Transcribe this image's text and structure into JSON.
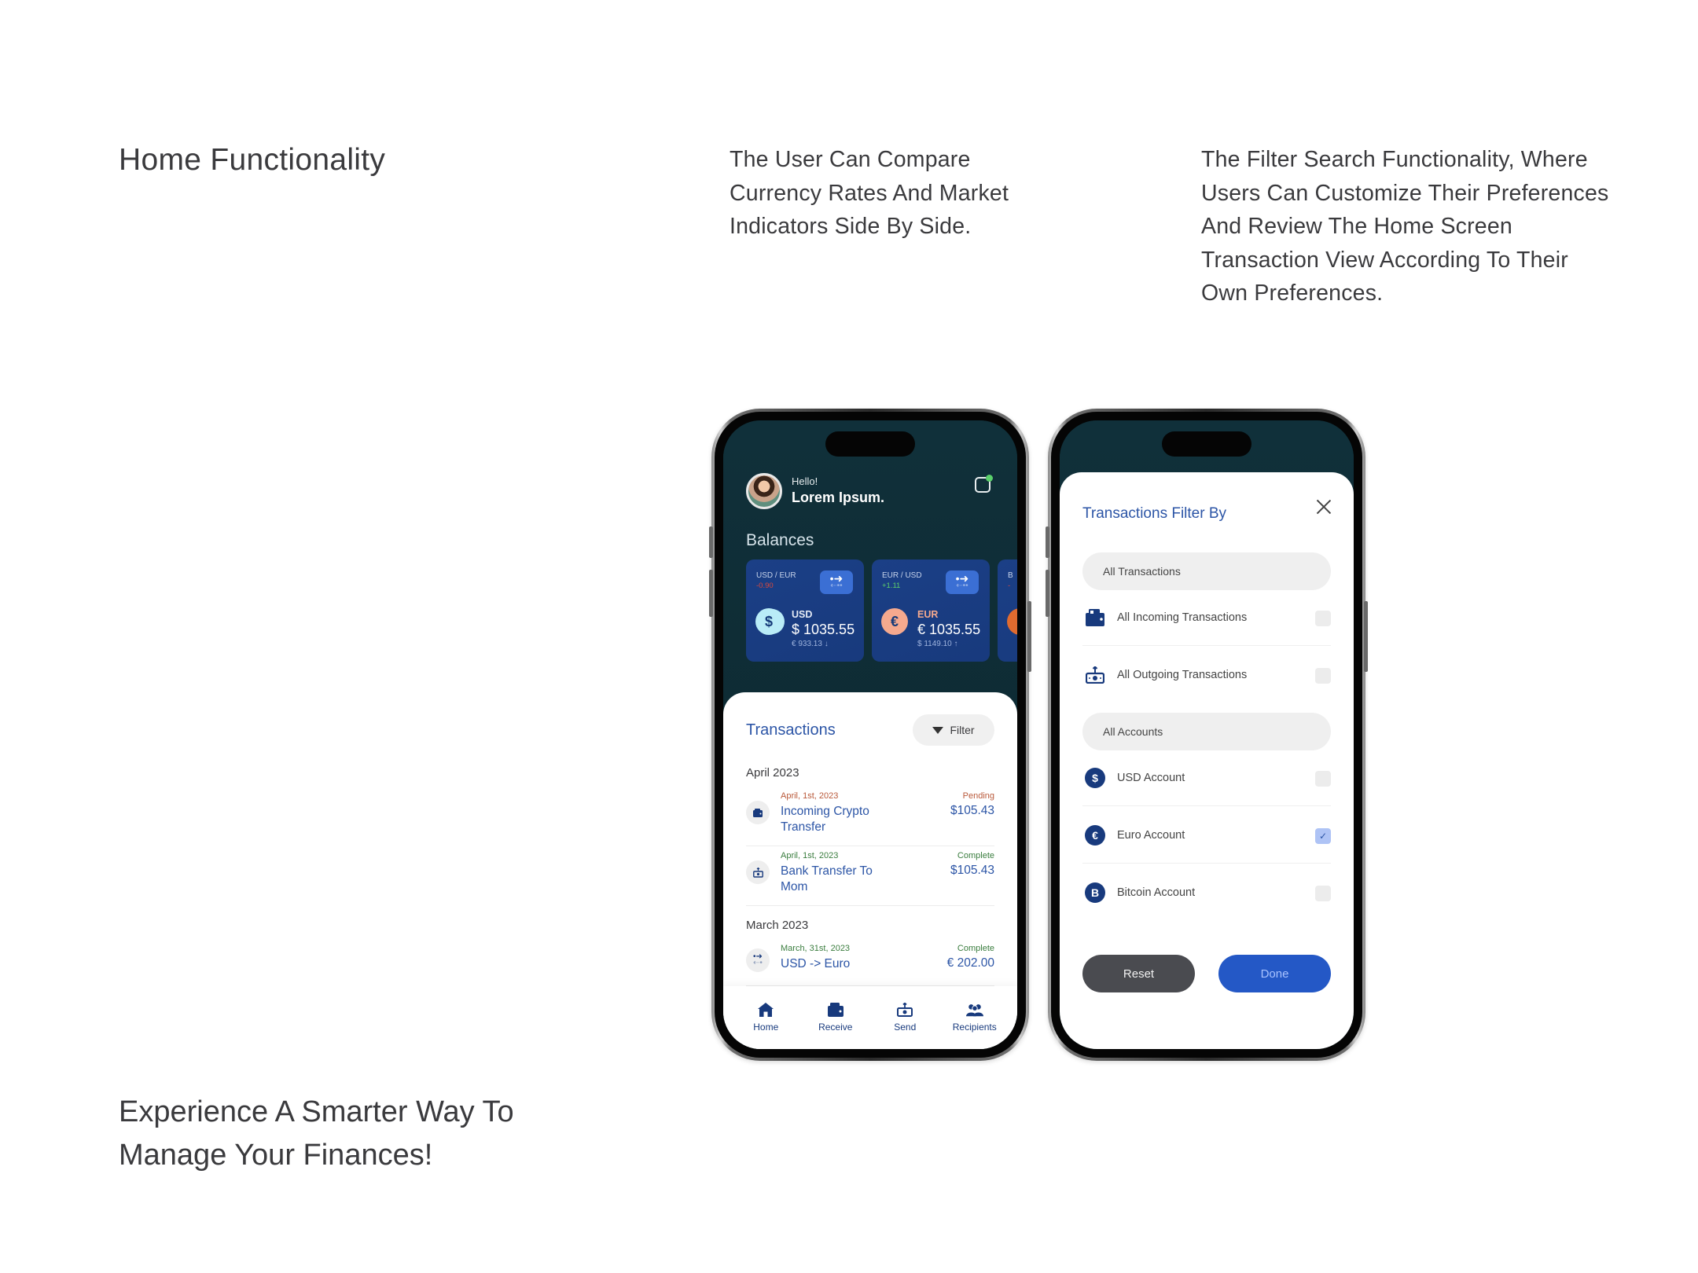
{
  "page": {
    "heading": "Home Functionality",
    "blurb_compare": "The User Can Compare Currency Rates And Market Indicators Side By Side.",
    "blurb_filter": "The Filter Search Functionality, Where Users Can Customize Their Preferences And Review The Home Screen Transaction View According To Their Own Preferences.",
    "tagline": "Experience A Smarter Way To Manage Your Finances!"
  },
  "home_screen": {
    "greeting": "Hello!",
    "user_name": "Lorem Ipsum.",
    "notification_icon": "notification-icon",
    "notification_dot_color": "#5bd06c",
    "balances_title": "Balances",
    "cards": [
      {
        "pair": "USD / EUR",
        "change": "-0.90",
        "trend": "negative",
        "currency_code": "USD",
        "amount": "$ 1035.55",
        "converted": "€ 933.13 ↓",
        "coin_symbol": "$"
      },
      {
        "pair": "EUR / USD",
        "change": "+1.11",
        "trend": "positive",
        "currency_code": "EUR",
        "amount": "€ 1035.55",
        "converted": "$ 1149.10 ↑",
        "coin_symbol": "€"
      },
      {
        "pair": "B",
        "change": "-",
        "trend": "negative",
        "currency_code": "",
        "amount": "",
        "converted": "",
        "coin_symbol": ""
      }
    ],
    "swap_icon": "⇄",
    "transactions_title": "Transactions",
    "filter_label": "Filter",
    "groups": [
      {
        "month": "April 2023",
        "items": [
          {
            "date": "April, 1st, 2023",
            "name": "Incoming Crypto Transfer",
            "status": "Pending",
            "amount": "$105.43",
            "icon": "wallet-icon"
          },
          {
            "date": "April, 1st, 2023",
            "name": "Bank Transfer To Mom",
            "status": "Complete",
            "amount": "$105.43",
            "icon": "send-money-icon"
          }
        ]
      },
      {
        "month": "March 2023",
        "items": [
          {
            "date": "March, 31st, 2023",
            "name": "USD -> Euro",
            "status": "Complete",
            "amount": "€ 202.00",
            "icon": "exchange-icon"
          }
        ]
      }
    ],
    "tabs": [
      {
        "label": "Home",
        "icon": "home-icon",
        "active": true
      },
      {
        "label": "Receive",
        "icon": "wallet-icon",
        "active": false
      },
      {
        "label": "Send",
        "icon": "send-money-icon",
        "active": false
      },
      {
        "label": "Recipients",
        "icon": "people-icon",
        "active": false
      }
    ]
  },
  "filter_screen": {
    "title": "Transactions Filter By",
    "close_icon": "close-icon",
    "sections": [
      {
        "label": "All Transactions",
        "options": [
          {
            "label": "All Incoming Transactions",
            "icon": "wallet-icon",
            "checked": false
          },
          {
            "label": "All Outgoing Transactions",
            "icon": "send-money-icon",
            "checked": false
          }
        ]
      },
      {
        "label": "All Accounts",
        "options": [
          {
            "label": "USD Account",
            "icon": "dollar-coin-icon",
            "symbol": "$",
            "checked": false
          },
          {
            "label": "Euro Account",
            "icon": "euro-coin-icon",
            "symbol": "€",
            "checked": true
          },
          {
            "label": "Bitcoin Account",
            "icon": "bitcoin-coin-icon",
            "symbol": "B",
            "checked": false
          }
        ]
      }
    ],
    "check_glyph": "✓",
    "reset_label": "Reset",
    "done_label": "Done"
  },
  "colors": {
    "primary_blue": "#2c55a6",
    "navy": "#183a7d",
    "dark_teal_bg": "#0f2f37",
    "done_button": "#2458c6",
    "reset_button": "#4a4b50",
    "pending": "#b9593a",
    "complete": "#3a7d3e",
    "negative": "#d9493c",
    "positive": "#5ed06a"
  }
}
